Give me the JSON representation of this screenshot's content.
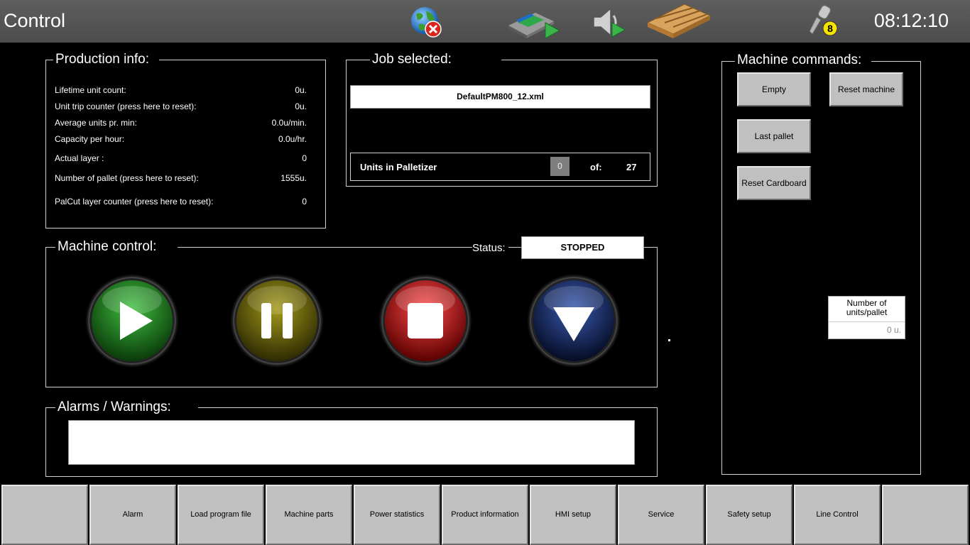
{
  "header": {
    "title": "Control",
    "clock": "08:12:10",
    "icons": [
      "globe-offline-icon",
      "conveyor-run-icon",
      "speaker-play-icon",
      "pallet-icon",
      "key-icon"
    ],
    "key_level": "8"
  },
  "production_info": {
    "title": "Production info:",
    "rows": [
      {
        "label": "Lifetime unit count:",
        "value": "0u."
      },
      {
        "label": "Unit trip counter (press here to reset):",
        "value": "0u."
      },
      {
        "label": "Average units pr. min:",
        "value": "0.0u/min."
      },
      {
        "label": "Capacity per hour:",
        "value": "0.0u/hr."
      },
      {
        "label": "Actual layer :",
        "value": "0"
      },
      {
        "label": "Number of pallet (press here to reset):",
        "value": "1555u."
      },
      {
        "label": "PalCut layer counter (press here to reset):",
        "value": "0"
      }
    ]
  },
  "job_selected": {
    "title": "Job selected:",
    "file": "DefaultPM800_12.xml",
    "units_label": "Units in Palletizer",
    "units_count": "0",
    "of_label": "of:",
    "units_total": "27"
  },
  "machine_control": {
    "title": "Machine control:",
    "status_label": "Status:",
    "status_value": "STOPPED",
    "buttons": [
      {
        "name": "start",
        "color": "#1f7a1f"
      },
      {
        "name": "pause",
        "color": "#6e6a0a"
      },
      {
        "name": "stop",
        "color": "#c01818"
      },
      {
        "name": "down",
        "color": "#10204e"
      }
    ]
  },
  "alarms": {
    "title": "Alarms / Warnings:",
    "text": ""
  },
  "machine_commands": {
    "title": "Machine commands:",
    "empty": "Empty",
    "reset_machine": "Reset machine",
    "last_pallet": "Last pallet",
    "reset_cardboard": "Reset Cardboard",
    "units_per_pallet_label": "Number of units/pallet",
    "units_per_pallet_value": "0 u."
  },
  "bottom_nav": [
    "",
    "Alarm",
    "Load program file",
    "Machine parts",
    "Power statistics",
    "Product information",
    "HMI setup",
    "Service",
    "Safety setup",
    "Line Control",
    ""
  ]
}
